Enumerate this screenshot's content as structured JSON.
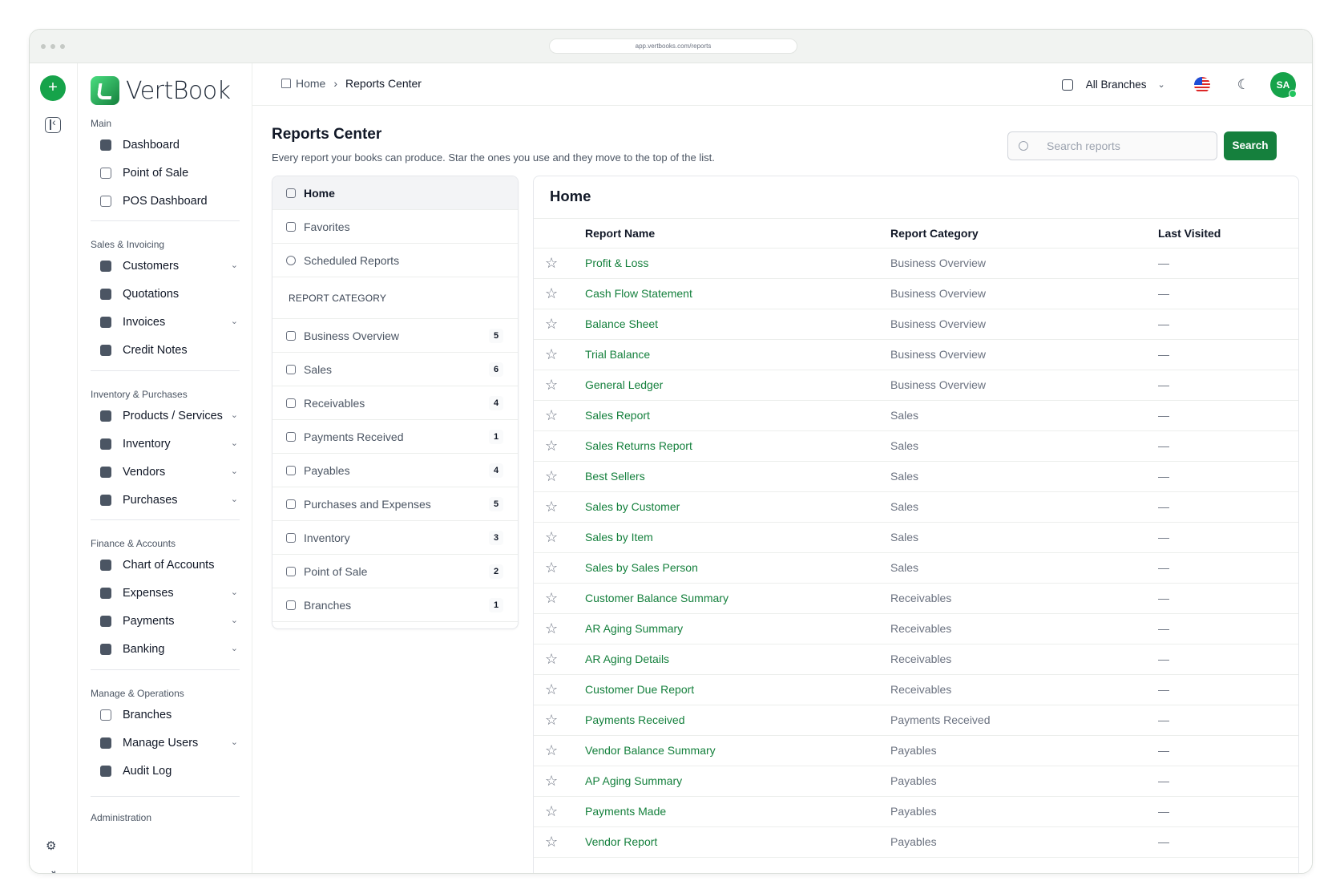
{
  "browser": {
    "url": "app.vertbooks.com/reports"
  },
  "brand": {
    "name": "VertBook"
  },
  "sidebar": {
    "sections": [
      {
        "title": "Main",
        "items": [
          {
            "label": "Dashboard",
            "icon": "grid-icon"
          },
          {
            "label": "Point of Sale",
            "icon": "store-icon"
          },
          {
            "label": "POS Dashboard",
            "icon": "bar-chart-icon"
          }
        ]
      },
      {
        "title": "Sales & Invoicing",
        "items": [
          {
            "label": "Customers",
            "icon": "users-icon",
            "expandable": true
          },
          {
            "label": "Quotations",
            "icon": "quote-icon"
          },
          {
            "label": "Invoices",
            "icon": "invoice-icon",
            "expandable": true
          },
          {
            "label": "Credit Notes",
            "icon": "credit-note-icon"
          }
        ]
      },
      {
        "title": "Inventory & Purchases",
        "items": [
          {
            "label": "Products / Services",
            "icon": "box-icon",
            "expandable": true
          },
          {
            "label": "Inventory",
            "icon": "inventory-icon",
            "expandable": true
          },
          {
            "label": "Vendors",
            "icon": "vendors-icon",
            "expandable": true
          },
          {
            "label": "Purchases",
            "icon": "bag-icon",
            "expandable": true
          }
        ]
      },
      {
        "title": "Finance & Accounts",
        "items": [
          {
            "label": "Chart of Accounts",
            "icon": "ledger-icon"
          },
          {
            "label": "Expenses",
            "icon": "expense-icon",
            "expandable": true
          },
          {
            "label": "Payments",
            "icon": "payment-icon",
            "expandable": true
          },
          {
            "label": "Banking",
            "icon": "bank-icon",
            "expandable": true
          }
        ]
      },
      {
        "title": "Manage & Operations",
        "items": [
          {
            "label": "Branches",
            "icon": "branch-icon"
          },
          {
            "label": "Manage Users",
            "icon": "user-manage-icon",
            "expandable": true
          },
          {
            "label": "Audit Log",
            "icon": "audit-icon"
          }
        ]
      }
    ],
    "cut_section": "Administration"
  },
  "topbar": {
    "breadcrumb": {
      "home": "Home",
      "current": "Reports Center"
    },
    "branch_selector": "All Branches",
    "avatar": "SA"
  },
  "page": {
    "title": "Reports Center",
    "subtitle": "Every report your books can produce. Star the ones you use and they move to the top of the list.",
    "search_placeholder": "Search reports",
    "search_button": "Search"
  },
  "left_nav": {
    "top": [
      {
        "label": "Home",
        "active": true
      },
      {
        "label": "Favorites"
      },
      {
        "label": "Scheduled Reports"
      }
    ],
    "category_header": "REPORT CATEGORY",
    "categories": [
      {
        "label": "Business Overview",
        "count": "5"
      },
      {
        "label": "Sales",
        "count": "6"
      },
      {
        "label": "Receivables",
        "count": "4"
      },
      {
        "label": "Payments Received",
        "count": "1"
      },
      {
        "label": "Payables",
        "count": "4"
      },
      {
        "label": "Purchases and Expenses",
        "count": "5"
      },
      {
        "label": "Inventory",
        "count": "3"
      },
      {
        "label": "Point of Sale",
        "count": "2"
      },
      {
        "label": "Branches",
        "count": "1"
      }
    ]
  },
  "table": {
    "title": "Home",
    "headers": {
      "name": "Report Name",
      "category": "Report Category",
      "visited": "Last Visited"
    },
    "rows": [
      {
        "name": "Profit & Loss",
        "category": "Business Overview",
        "visited": "—"
      },
      {
        "name": "Cash Flow Statement",
        "category": "Business Overview",
        "visited": "—"
      },
      {
        "name": "Balance Sheet",
        "category": "Business Overview",
        "visited": "—"
      },
      {
        "name": "Trial Balance",
        "category": "Business Overview",
        "visited": "—"
      },
      {
        "name": "General Ledger",
        "category": "Business Overview",
        "visited": "—"
      },
      {
        "name": "Sales Report",
        "category": "Sales",
        "visited": "—"
      },
      {
        "name": "Sales Returns Report",
        "category": "Sales",
        "visited": "—"
      },
      {
        "name": "Best Sellers",
        "category": "Sales",
        "visited": "—"
      },
      {
        "name": "Sales by Customer",
        "category": "Sales",
        "visited": "—"
      },
      {
        "name": "Sales by Item",
        "category": "Sales",
        "visited": "—"
      },
      {
        "name": "Sales by Sales Person",
        "category": "Sales",
        "visited": "—"
      },
      {
        "name": "Customer Balance Summary",
        "category": "Receivables",
        "visited": "—"
      },
      {
        "name": "AR Aging Summary",
        "category": "Receivables",
        "visited": "—"
      },
      {
        "name": "AR Aging Details",
        "category": "Receivables",
        "visited": "—"
      },
      {
        "name": "Customer Due Report",
        "category": "Receivables",
        "visited": "—"
      },
      {
        "name": "Payments Received",
        "category": "Payments Received",
        "visited": "—"
      },
      {
        "name": "Vendor Balance Summary",
        "category": "Payables",
        "visited": "—"
      },
      {
        "name": "AP Aging Summary",
        "category": "Payables",
        "visited": "—"
      },
      {
        "name": "Payments Made",
        "category": "Payables",
        "visited": "—"
      },
      {
        "name": "Vendor Report",
        "category": "Payables",
        "visited": "—"
      }
    ]
  },
  "colors": {
    "accent": "#15803d",
    "brand_green": "#16a34a"
  }
}
